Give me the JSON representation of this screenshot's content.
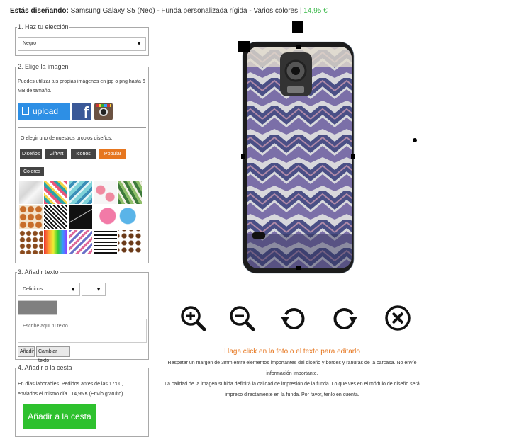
{
  "header": {
    "label": "Estás diseñando:",
    "product": "Samsung Galaxy S5 (Neo) - Funda personalizada rígida - Varios colores",
    "separator": "|",
    "price": "14,95 €"
  },
  "step1": {
    "legend": "1. Haz tu elección",
    "color_select": "Negro"
  },
  "step2": {
    "legend": "2. Elige la imagen",
    "help": "Puedes utilizar tus propias imágenes en jpg o png hasta 6 MB de tamaño.",
    "upload_label": "upload",
    "facebook_glyph": "f",
    "or_text": "O elegir uno de nuestros propios diseños:",
    "tags": [
      "Diseños",
      "GiftArt",
      "Iconos",
      "Popular",
      "Colores"
    ],
    "active_tag": "Popular",
    "thumbnails": [
      "marble-white",
      "tropical-leaves",
      "aqua-pattern",
      "flamingos",
      "palm-leaves",
      "giraffe-print",
      "black-white-zigzag",
      "black-marble",
      "pink-heart-half",
      "blue-heart-half",
      "coffee-beans",
      "rainbow-drips",
      "colorful-chevron",
      "black-white-stripes",
      "coffee-beans-2"
    ]
  },
  "step3": {
    "legend": "3. Añadir texto",
    "font_select": "Delicious",
    "size_select": "",
    "text_color": "#808080",
    "placeholder": "Escribe aquí tu texto...",
    "add_button": "Añadir",
    "change_button": "Cambiar texto"
  },
  "step4": {
    "legend": "4. Añadir a la cesta",
    "line1": "En días laborables. Pedidos antes de las 17:00,",
    "line2": "enviados el mismo día | 14,95 € (Envío gratuito)",
    "cart_button": "Añadir a la cesta"
  },
  "editor": {
    "tools": [
      "zoom-in-icon",
      "zoom-out-icon",
      "rotate-left-icon",
      "rotate-right-icon",
      "remove-icon"
    ],
    "hint": "Haga click en la foto o el texto para editarlo",
    "info1": "Respetar un margen de 3mm entre elementos importantes del diseño y bordes y ranuras de la carcasa. No envíe",
    "info2": "información importante.",
    "info3": "La calidad de la imagen subida definirá la calidad de impresión de la funda. Lo que ves en el módulo de diseño será",
    "info4": "impreso directamente en la funda. Por favor, tenlo en cuenta."
  },
  "colors": {
    "accent": "#e6761f",
    "price": "#3bb84a",
    "upload": "#2d8fe5",
    "facebook": "#3b5998",
    "cart": "#2ec12e"
  }
}
